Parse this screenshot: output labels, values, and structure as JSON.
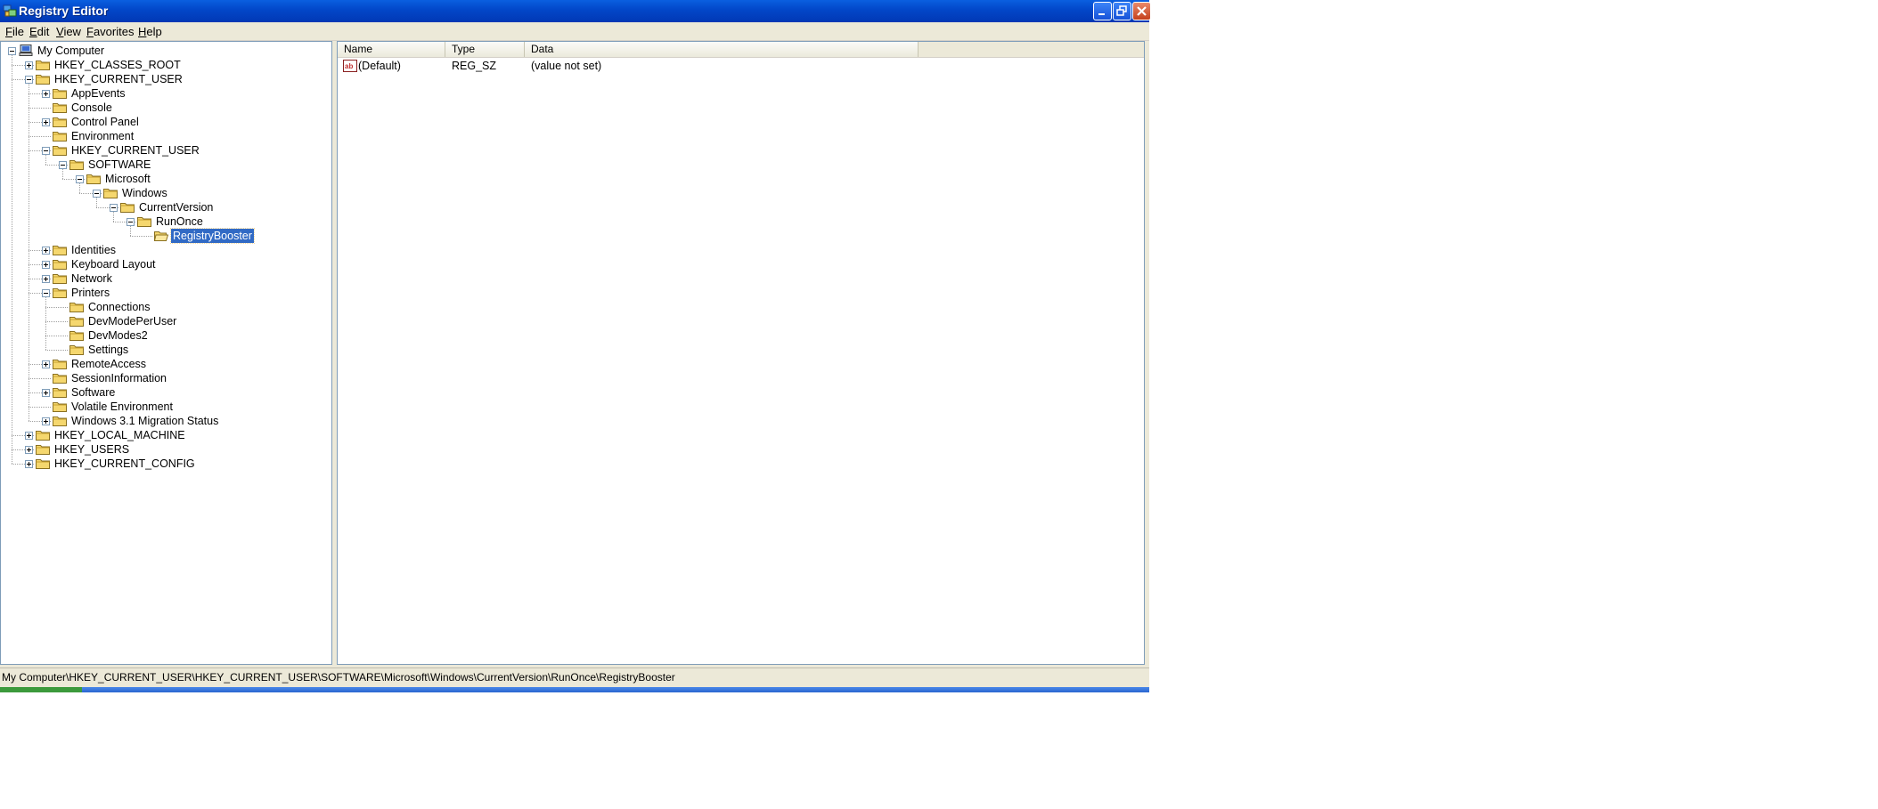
{
  "window": {
    "title": "Registry Editor",
    "buttons": [
      "minimize",
      "restore",
      "close"
    ]
  },
  "menu": [
    "File",
    "Edit",
    "View",
    "Favorites",
    "Help"
  ],
  "tree": [
    {
      "label": "My Computer",
      "icon": "computer-icon",
      "level": 0,
      "expander": "minus"
    },
    {
      "label": "HKEY_CLASSES_ROOT",
      "icon": "folder-icon",
      "level": 1,
      "expander": "plus"
    },
    {
      "label": "HKEY_CURRENT_USER",
      "icon": "folder-icon",
      "level": 1,
      "expander": "minus"
    },
    {
      "label": "AppEvents",
      "icon": "folder-icon",
      "level": 2,
      "expander": "plus"
    },
    {
      "label": "Console",
      "icon": "folder-icon",
      "level": 2,
      "expander": ""
    },
    {
      "label": "Control Panel",
      "icon": "folder-icon",
      "level": 2,
      "expander": "plus"
    },
    {
      "label": "Environment",
      "icon": "folder-icon",
      "level": 2,
      "expander": ""
    },
    {
      "label": "HKEY_CURRENT_USER",
      "icon": "folder-icon",
      "level": 2,
      "expander": "minus"
    },
    {
      "label": "SOFTWARE",
      "icon": "folder-icon",
      "level": 3,
      "expander": "minus"
    },
    {
      "label": "Microsoft",
      "icon": "folder-icon",
      "level": 4,
      "expander": "minus"
    },
    {
      "label": "Windows",
      "icon": "folder-icon",
      "level": 5,
      "expander": "minus"
    },
    {
      "label": "CurrentVersion",
      "icon": "folder-icon",
      "level": 6,
      "expander": "minus"
    },
    {
      "label": "RunOnce",
      "icon": "folder-icon",
      "level": 7,
      "expander": "minus"
    },
    {
      "label": "RegistryBooster",
      "icon": "open-folder-icon",
      "level": 8,
      "expander": "",
      "selected": true
    },
    {
      "label": "Identities",
      "icon": "folder-icon",
      "level": 2,
      "expander": "plus"
    },
    {
      "label": "Keyboard Layout",
      "icon": "folder-icon",
      "level": 2,
      "expander": "plus"
    },
    {
      "label": "Network",
      "icon": "folder-icon",
      "level": 2,
      "expander": "plus"
    },
    {
      "label": "Printers",
      "icon": "folder-icon",
      "level": 2,
      "expander": "minus"
    },
    {
      "label": "Connections",
      "icon": "folder-icon",
      "level": 3,
      "expander": ""
    },
    {
      "label": "DevModePerUser",
      "icon": "folder-icon",
      "level": 3,
      "expander": ""
    },
    {
      "label": "DevModes2",
      "icon": "folder-icon",
      "level": 3,
      "expander": ""
    },
    {
      "label": "Settings",
      "icon": "folder-icon",
      "level": 3,
      "expander": ""
    },
    {
      "label": "RemoteAccess",
      "icon": "folder-icon",
      "level": 2,
      "expander": "plus"
    },
    {
      "label": "SessionInformation",
      "icon": "folder-icon",
      "level": 2,
      "expander": ""
    },
    {
      "label": "Software",
      "icon": "folder-icon",
      "level": 2,
      "expander": "plus"
    },
    {
      "label": "Volatile Environment",
      "icon": "folder-icon",
      "level": 2,
      "expander": ""
    },
    {
      "label": "Windows 3.1 Migration Status",
      "icon": "folder-icon",
      "level": 2,
      "expander": "plus"
    },
    {
      "label": "HKEY_LOCAL_MACHINE",
      "icon": "folder-icon",
      "level": 1,
      "expander": "plus"
    },
    {
      "label": "HKEY_USERS",
      "icon": "folder-icon",
      "level": 1,
      "expander": "plus"
    },
    {
      "label": "HKEY_CURRENT_CONFIG",
      "icon": "folder-icon",
      "level": 1,
      "expander": "plus"
    }
  ],
  "list": {
    "columns": [
      "Name",
      "Type",
      "Data"
    ],
    "rows": [
      {
        "name": "(Default)",
        "type": "REG_SZ",
        "data": "(value not set)",
        "icon": "string-value-icon"
      }
    ]
  },
  "status": {
    "path": "My Computer\\HKEY_CURRENT_USER\\HKEY_CURRENT_USER\\SOFTWARE\\Microsoft\\Windows\\CurrentVersion\\RunOnce\\RegistryBooster"
  },
  "colors": {
    "title_bar": "#0246c8",
    "selection": "#316ac5",
    "window_face": "#ece9d8",
    "folder": "#f5d76e"
  }
}
